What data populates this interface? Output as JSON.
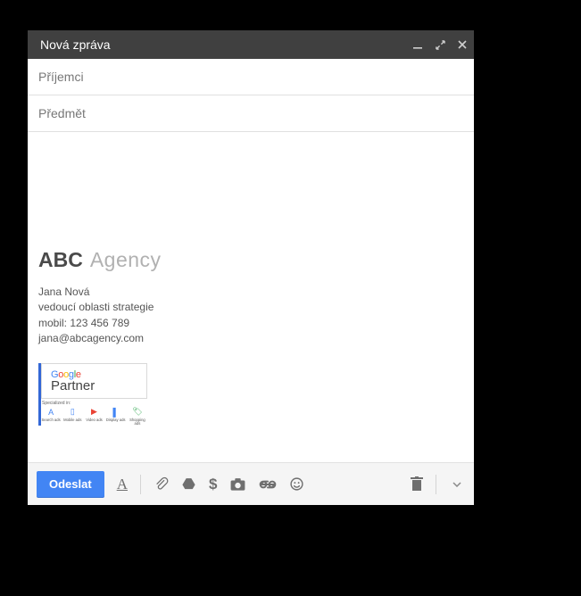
{
  "compose": {
    "title": "Nová zpráva",
    "recipients_placeholder": "Příjemci",
    "subject_placeholder": "Předmět",
    "send_label": "Odeslat"
  },
  "signature": {
    "agency_bold": "ABC",
    "agency_thin": "Agency",
    "name": "Jana Nová",
    "role": "vedoucí oblasti strategie",
    "mobile": "mobil: 123 456 789",
    "email": "jana@abcagency.com"
  },
  "partner": {
    "google": [
      "G",
      "o",
      "o",
      "g",
      "l",
      "e"
    ],
    "partner_word": "Partner",
    "spec_label": "Specialized in:",
    "spec_items": [
      {
        "label": "Search ads",
        "color": "#4285F4",
        "glyph": "A"
      },
      {
        "label": "Mobile ads",
        "color": "#4285F4",
        "glyph": "▯"
      },
      {
        "label": "Video ads",
        "color": "#EA4335",
        "glyph": "▶"
      },
      {
        "label": "Display ads",
        "color": "#4285F4",
        "glyph": "▌"
      },
      {
        "label": "Shopping ads",
        "color": "#34A853",
        "glyph": "🏷"
      }
    ]
  },
  "icons": {
    "minimize": "minimize",
    "expand": "expand",
    "close": "close"
  }
}
